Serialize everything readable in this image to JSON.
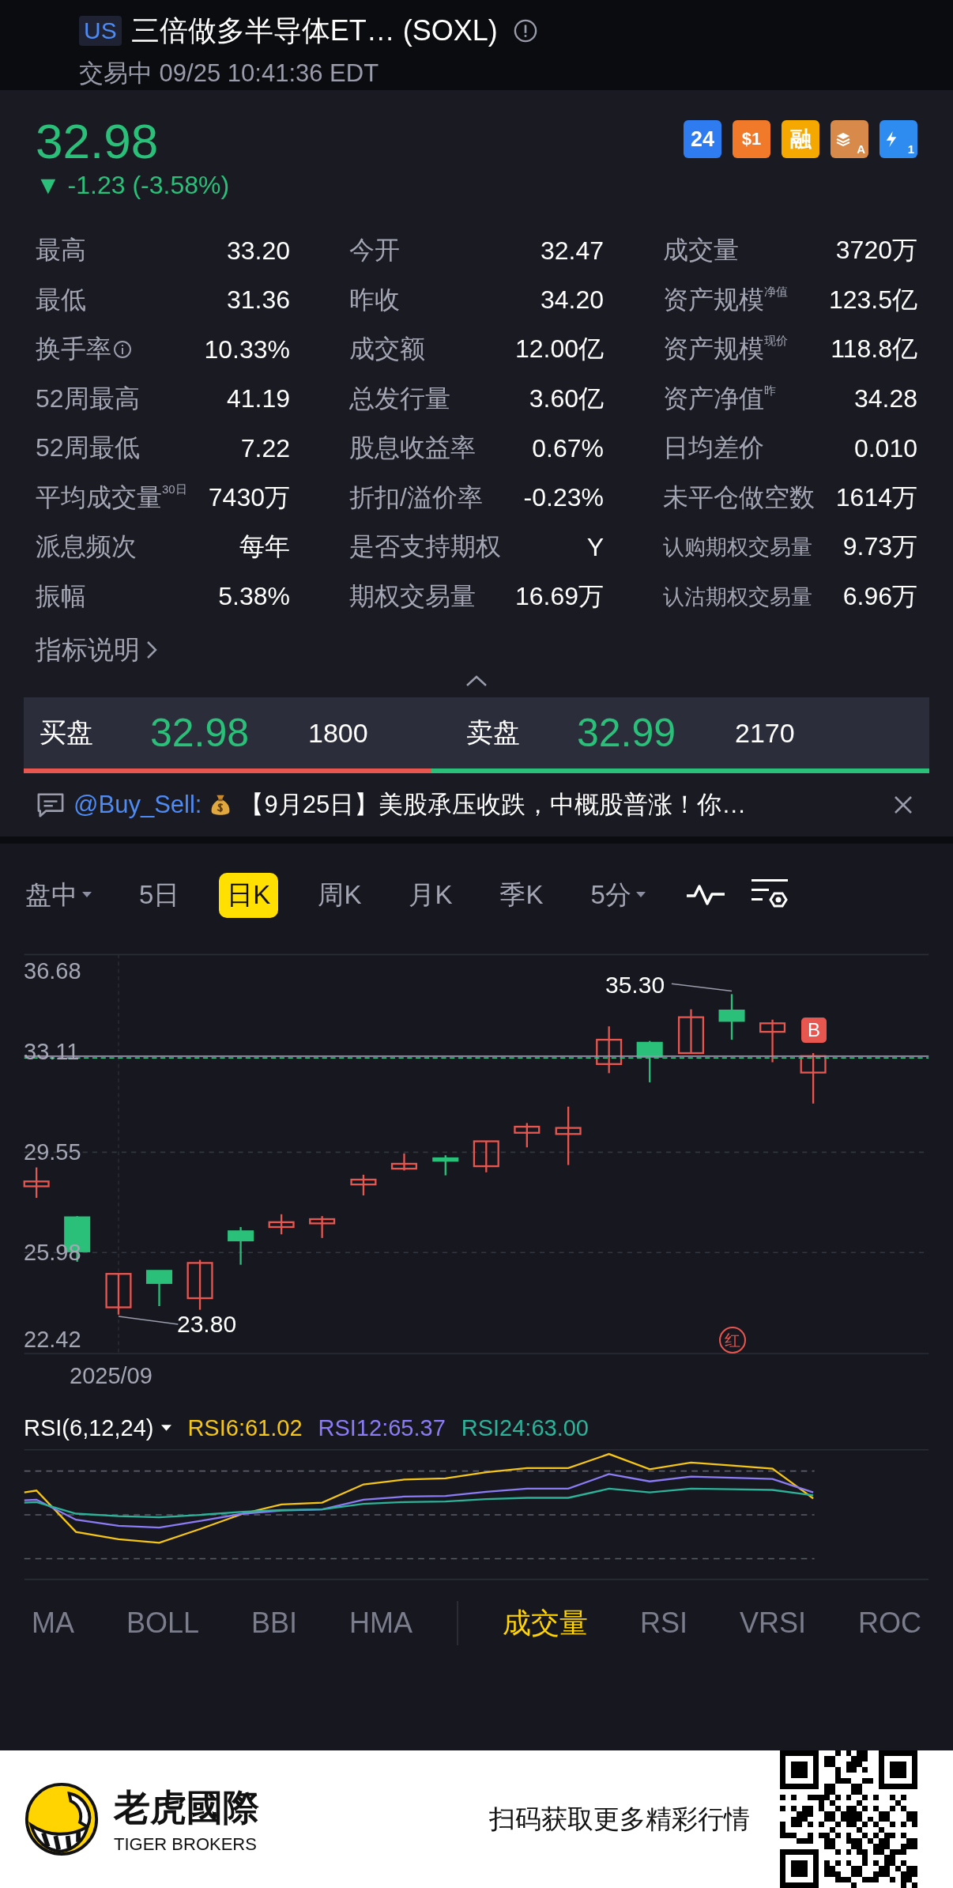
{
  "header": {
    "market": "US",
    "title": "三倍做多半导体ET… (SOXL)",
    "status": "交易中 09/25 10:41:36 EDT"
  },
  "quote": {
    "price": "32.98",
    "change": "▼ -1.23 (-3.58%)"
  },
  "badges": [
    {
      "kind": "text",
      "text": "24",
      "color": "#2e7cf0"
    },
    {
      "kind": "ticket",
      "text": "$1",
      "color": "#f07a2a"
    },
    {
      "kind": "text",
      "text": "融",
      "color": "#f5a800"
    },
    {
      "kind": "layers",
      "text": "A",
      "color": "#d88a4a"
    },
    {
      "kind": "bolt",
      "text": "1",
      "color": "#2e8cf0"
    }
  ],
  "stats": [
    [
      {
        "label": "最高",
        "value": "33.20"
      },
      {
        "label": "最低",
        "value": "31.36"
      },
      {
        "label": "换手率",
        "value": "10.33%",
        "info": true
      },
      {
        "label": "52周最高",
        "value": "41.19"
      },
      {
        "label": "52周最低",
        "value": "7.22"
      },
      {
        "label": "平均成交量",
        "sup": "30日",
        "value": "7430万"
      },
      {
        "label": "派息频次",
        "value": "每年"
      },
      {
        "label": "振幅",
        "value": "5.38%"
      }
    ],
    [
      {
        "label": "今开",
        "value": "32.47"
      },
      {
        "label": "昨收",
        "value": "34.20"
      },
      {
        "label": "成交额",
        "value": "12.00亿"
      },
      {
        "label": "总发行量",
        "value": "3.60亿"
      },
      {
        "label": "股息收益率",
        "value": "0.67%"
      },
      {
        "label": "折扣/溢价率",
        "value": "-0.23%"
      },
      {
        "label": "是否支持期权",
        "value": "Y"
      },
      {
        "label": "期权交易量",
        "value": "16.69万"
      }
    ],
    [
      {
        "label": "成交量",
        "value": "3720万"
      },
      {
        "label": "资产规模",
        "sup": "净值",
        "value": "123.5亿"
      },
      {
        "label": "资产规模",
        "sup": "现价",
        "value": "118.8亿"
      },
      {
        "label": "资产净值",
        "sup": "昨",
        "value": "34.28"
      },
      {
        "label": "日均差价",
        "value": "0.010"
      },
      {
        "label": "未平仓做空数",
        "value": "1614万"
      },
      {
        "label": "认购期权交易量",
        "value": "9.73万",
        "small": true
      },
      {
        "label": "认沽期权交易量",
        "value": "6.96万",
        "small": true
      }
    ]
  ],
  "indicator_link": "指标说明",
  "order_book": {
    "bid_label": "买盘",
    "bid_price": "32.98",
    "bid_size": "1800",
    "ask_label": "卖盘",
    "ask_price": "32.99",
    "ask_size": "2170",
    "level": 0.45
  },
  "news": {
    "author": "@Buy_Sell:",
    "text": "【9月25日】美股承压收跌，中概股普涨！你…"
  },
  "period_tabs": [
    {
      "label": "盘中",
      "selected": false,
      "dropdown": true
    },
    {
      "label": "5日",
      "selected": false,
      "dropdown": false
    },
    {
      "label": "日K",
      "selected": true,
      "dropdown": false
    },
    {
      "label": "周K",
      "selected": false,
      "dropdown": false
    },
    {
      "label": "月K",
      "selected": false,
      "dropdown": false
    },
    {
      "label": "季K",
      "selected": false,
      "dropdown": false
    },
    {
      "label": "5分",
      "selected": false,
      "dropdown": true
    }
  ],
  "price_chart": {
    "y_labels": [
      "36.68",
      "33.11",
      "29.55",
      "25.98",
      "22.42"
    ],
    "x_label": "2025/09",
    "high_label": "35.30",
    "low_label": "23.80",
    "markers": [
      {
        "kind": "flag",
        "text": "B"
      },
      {
        "kind": "circle",
        "text": "红"
      }
    ]
  },
  "rsi": {
    "title": "RSI(6,12,24)",
    "series": [
      {
        "label": "RSI6:61.02",
        "color": "#f5c518"
      },
      {
        "label": "RSI12:65.37",
        "color": "#8b7cf6"
      },
      {
        "label": "RSI24:63.00",
        "color": "#2db39a"
      }
    ]
  },
  "indicator_tabs": [
    {
      "label": "MA",
      "selected": false
    },
    {
      "label": "BOLL",
      "selected": false
    },
    {
      "label": "BBI",
      "selected": false
    },
    {
      "label": "HMA",
      "selected": false
    },
    {
      "label": "成交量",
      "selected": true
    },
    {
      "label": "RSI",
      "selected": false
    },
    {
      "label": "VRSI",
      "selected": false
    },
    {
      "label": "ROC",
      "selected": false
    }
  ],
  "footer": {
    "brand": "老虎國際",
    "brand_en": "TIGER BROKERS",
    "cta": "扫码获取更多精彩行情"
  }
}
